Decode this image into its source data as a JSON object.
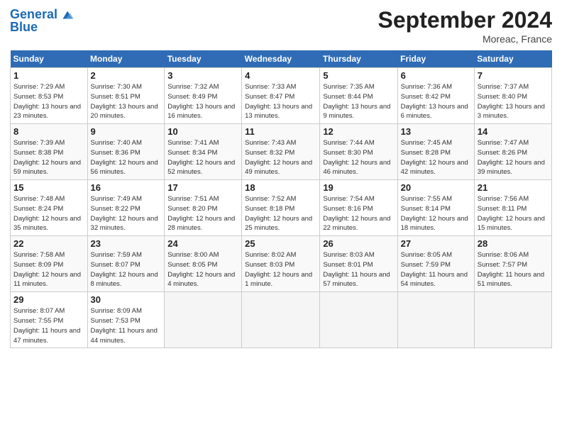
{
  "header": {
    "logo_line1": "General",
    "logo_line2": "Blue",
    "month": "September 2024",
    "location": "Moreac, France"
  },
  "days_of_week": [
    "Sunday",
    "Monday",
    "Tuesday",
    "Wednesday",
    "Thursday",
    "Friday",
    "Saturday"
  ],
  "weeks": [
    [
      {
        "day": "1",
        "sunrise": "Sunrise: 7:29 AM",
        "sunset": "Sunset: 8:53 PM",
        "daylight": "Daylight: 13 hours and 23 minutes."
      },
      {
        "day": "2",
        "sunrise": "Sunrise: 7:30 AM",
        "sunset": "Sunset: 8:51 PM",
        "daylight": "Daylight: 13 hours and 20 minutes."
      },
      {
        "day": "3",
        "sunrise": "Sunrise: 7:32 AM",
        "sunset": "Sunset: 8:49 PM",
        "daylight": "Daylight: 13 hours and 16 minutes."
      },
      {
        "day": "4",
        "sunrise": "Sunrise: 7:33 AM",
        "sunset": "Sunset: 8:47 PM",
        "daylight": "Daylight: 13 hours and 13 minutes."
      },
      {
        "day": "5",
        "sunrise": "Sunrise: 7:35 AM",
        "sunset": "Sunset: 8:44 PM",
        "daylight": "Daylight: 13 hours and 9 minutes."
      },
      {
        "day": "6",
        "sunrise": "Sunrise: 7:36 AM",
        "sunset": "Sunset: 8:42 PM",
        "daylight": "Daylight: 13 hours and 6 minutes."
      },
      {
        "day": "7",
        "sunrise": "Sunrise: 7:37 AM",
        "sunset": "Sunset: 8:40 PM",
        "daylight": "Daylight: 13 hours and 3 minutes."
      }
    ],
    [
      {
        "day": "8",
        "sunrise": "Sunrise: 7:39 AM",
        "sunset": "Sunset: 8:38 PM",
        "daylight": "Daylight: 12 hours and 59 minutes."
      },
      {
        "day": "9",
        "sunrise": "Sunrise: 7:40 AM",
        "sunset": "Sunset: 8:36 PM",
        "daylight": "Daylight: 12 hours and 56 minutes."
      },
      {
        "day": "10",
        "sunrise": "Sunrise: 7:41 AM",
        "sunset": "Sunset: 8:34 PM",
        "daylight": "Daylight: 12 hours and 52 minutes."
      },
      {
        "day": "11",
        "sunrise": "Sunrise: 7:43 AM",
        "sunset": "Sunset: 8:32 PM",
        "daylight": "Daylight: 12 hours and 49 minutes."
      },
      {
        "day": "12",
        "sunrise": "Sunrise: 7:44 AM",
        "sunset": "Sunset: 8:30 PM",
        "daylight": "Daylight: 12 hours and 46 minutes."
      },
      {
        "day": "13",
        "sunrise": "Sunrise: 7:45 AM",
        "sunset": "Sunset: 8:28 PM",
        "daylight": "Daylight: 12 hours and 42 minutes."
      },
      {
        "day": "14",
        "sunrise": "Sunrise: 7:47 AM",
        "sunset": "Sunset: 8:26 PM",
        "daylight": "Daylight: 12 hours and 39 minutes."
      }
    ],
    [
      {
        "day": "15",
        "sunrise": "Sunrise: 7:48 AM",
        "sunset": "Sunset: 8:24 PM",
        "daylight": "Daylight: 12 hours and 35 minutes."
      },
      {
        "day": "16",
        "sunrise": "Sunrise: 7:49 AM",
        "sunset": "Sunset: 8:22 PM",
        "daylight": "Daylight: 12 hours and 32 minutes."
      },
      {
        "day": "17",
        "sunrise": "Sunrise: 7:51 AM",
        "sunset": "Sunset: 8:20 PM",
        "daylight": "Daylight: 12 hours and 28 minutes."
      },
      {
        "day": "18",
        "sunrise": "Sunrise: 7:52 AM",
        "sunset": "Sunset: 8:18 PM",
        "daylight": "Daylight: 12 hours and 25 minutes."
      },
      {
        "day": "19",
        "sunrise": "Sunrise: 7:54 AM",
        "sunset": "Sunset: 8:16 PM",
        "daylight": "Daylight: 12 hours and 22 minutes."
      },
      {
        "day": "20",
        "sunrise": "Sunrise: 7:55 AM",
        "sunset": "Sunset: 8:14 PM",
        "daylight": "Daylight: 12 hours and 18 minutes."
      },
      {
        "day": "21",
        "sunrise": "Sunrise: 7:56 AM",
        "sunset": "Sunset: 8:11 PM",
        "daylight": "Daylight: 12 hours and 15 minutes."
      }
    ],
    [
      {
        "day": "22",
        "sunrise": "Sunrise: 7:58 AM",
        "sunset": "Sunset: 8:09 PM",
        "daylight": "Daylight: 12 hours and 11 minutes."
      },
      {
        "day": "23",
        "sunrise": "Sunrise: 7:59 AM",
        "sunset": "Sunset: 8:07 PM",
        "daylight": "Daylight: 12 hours and 8 minutes."
      },
      {
        "day": "24",
        "sunrise": "Sunrise: 8:00 AM",
        "sunset": "Sunset: 8:05 PM",
        "daylight": "Daylight: 12 hours and 4 minutes."
      },
      {
        "day": "25",
        "sunrise": "Sunrise: 8:02 AM",
        "sunset": "Sunset: 8:03 PM",
        "daylight": "Daylight: 12 hours and 1 minute."
      },
      {
        "day": "26",
        "sunrise": "Sunrise: 8:03 AM",
        "sunset": "Sunset: 8:01 PM",
        "daylight": "Daylight: 11 hours and 57 minutes."
      },
      {
        "day": "27",
        "sunrise": "Sunrise: 8:05 AM",
        "sunset": "Sunset: 7:59 PM",
        "daylight": "Daylight: 11 hours and 54 minutes."
      },
      {
        "day": "28",
        "sunrise": "Sunrise: 8:06 AM",
        "sunset": "Sunset: 7:57 PM",
        "daylight": "Daylight: 11 hours and 51 minutes."
      }
    ],
    [
      {
        "day": "29",
        "sunrise": "Sunrise: 8:07 AM",
        "sunset": "Sunset: 7:55 PM",
        "daylight": "Daylight: 11 hours and 47 minutes."
      },
      {
        "day": "30",
        "sunrise": "Sunrise: 8:09 AM",
        "sunset": "Sunset: 7:53 PM",
        "daylight": "Daylight: 11 hours and 44 minutes."
      },
      null,
      null,
      null,
      null,
      null
    ]
  ]
}
